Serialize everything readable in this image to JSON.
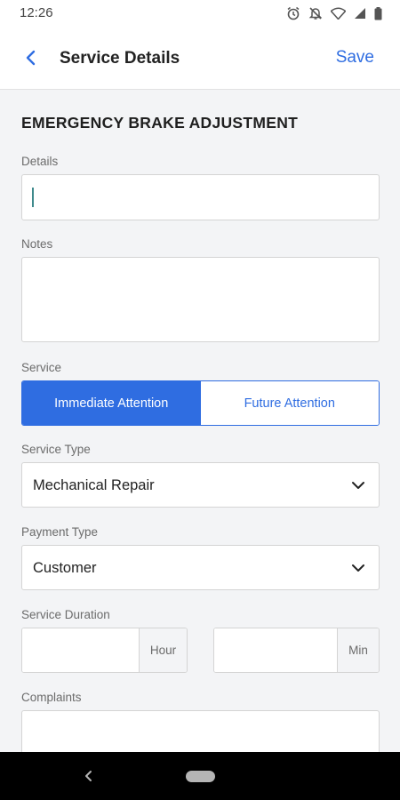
{
  "status_bar": {
    "time": "12:26",
    "icons": [
      "alarm-icon",
      "mute-icon",
      "wifi-icon",
      "signal-icon",
      "battery-icon"
    ]
  },
  "app_bar": {
    "title": "Service Details",
    "save_label": "Save",
    "back_icon": "chevron-left-icon"
  },
  "section_title": "EMERGENCY BRAKE ADJUSTMENT",
  "fields": {
    "details": {
      "label": "Details",
      "value": ""
    },
    "notes": {
      "label": "Notes",
      "value": ""
    },
    "service": {
      "label": "Service",
      "options": [
        "Immediate Attention",
        "Future Attention"
      ],
      "selected": "Immediate Attention"
    },
    "service_type": {
      "label": "Service Type",
      "value": "Mechanical Repair"
    },
    "payment_type": {
      "label": "Payment Type",
      "value": "Customer"
    },
    "service_duration": {
      "label": "Service Duration",
      "hour_unit": "Hour",
      "min_unit": "Min",
      "hour_value": "",
      "min_value": ""
    },
    "complaints": {
      "label": "Complaints",
      "value": ""
    }
  },
  "colors": {
    "accent": "#2f6de1",
    "background": "#f3f4f6",
    "border": "#d4d4d4"
  }
}
